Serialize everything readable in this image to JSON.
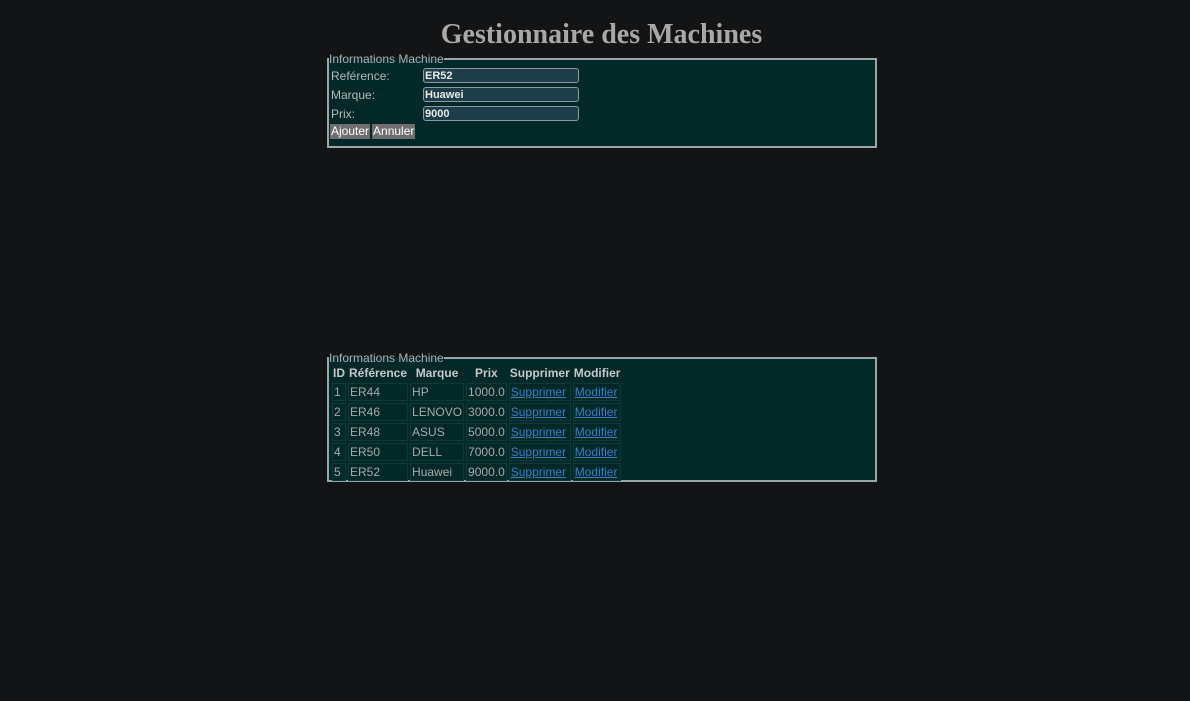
{
  "page": {
    "title": "Gestionnaire des Machines"
  },
  "form": {
    "legend": "Informations Machine",
    "fields": [
      {
        "label": "Reférence:",
        "value": "ER52"
      },
      {
        "label": "Marque:",
        "value": "Huawei"
      },
      {
        "label": "Prix:",
        "value": "9000"
      }
    ],
    "add_label": "Ajouter",
    "cancel_label": "Annuler"
  },
  "table": {
    "legend": "Informations Machine",
    "headers": [
      "ID",
      "Référence",
      "Marque",
      "Prix",
      "Supprimer",
      "Modifier"
    ],
    "rows": [
      {
        "id": "1",
        "ref": "ER44",
        "marque": "HP",
        "prix": "1000.0",
        "delete": "Supprimer",
        "edit": "Modifier"
      },
      {
        "id": "2",
        "ref": "ER46",
        "marque": "LENOVO",
        "prix": "3000.0",
        "delete": "Supprimer",
        "edit": "Modifier"
      },
      {
        "id": "3",
        "ref": "ER48",
        "marque": "ASUS",
        "prix": "5000.0",
        "delete": "Supprimer",
        "edit": "Modifier"
      },
      {
        "id": "4",
        "ref": "ER50",
        "marque": "DELL",
        "prix": "7000.0",
        "delete": "Supprimer",
        "edit": "Modifier"
      },
      {
        "id": "5",
        "ref": "ER52",
        "marque": "Huawei",
        "prix": "9000.0",
        "delete": "Supprimer",
        "edit": "Modifier"
      }
    ]
  },
  "colors": {
    "background": "#131416",
    "panel": "#022828",
    "link": "#3a7fc4",
    "button": "#6e6e6e"
  }
}
